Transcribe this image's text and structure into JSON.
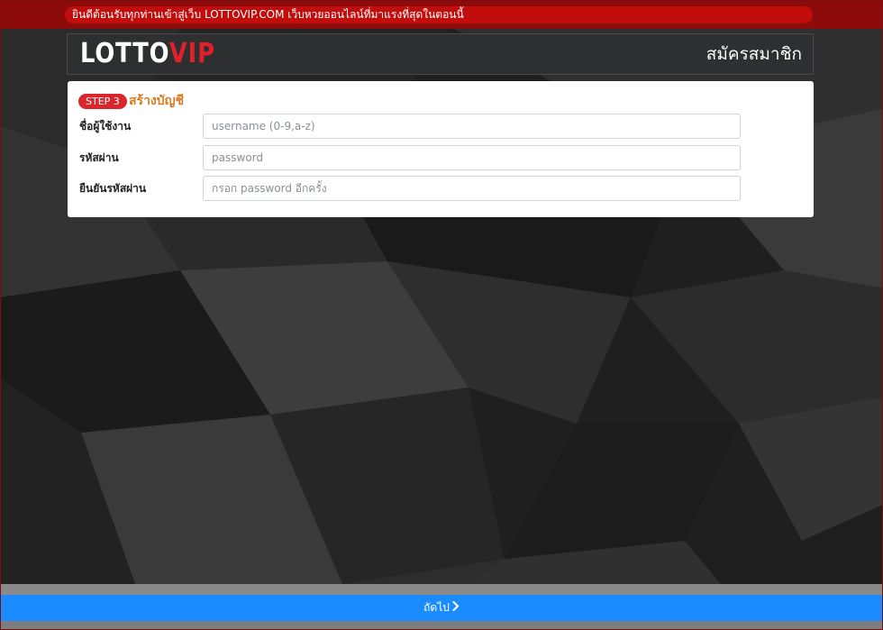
{
  "announcement": {
    "text": "ยินดีต้อนรับทุกท่านเข้าสู่เว็บ LOTTOVIP.COM เว็บหวยออนไลน์ที่มาแรงที่สุดในตอนนี้"
  },
  "header": {
    "logo_white": "LOTTO",
    "logo_red": "VIP",
    "title": "สมัครสมาชิก"
  },
  "step": {
    "badge": "STEP 3",
    "title": "สร้างบัญชี"
  },
  "form": {
    "username": {
      "label": "ชื่อผู้ใช้งาน",
      "placeholder": "username (0-9,a-z)",
      "value": ""
    },
    "password": {
      "label": "รหัสผ่าน",
      "placeholder": "password",
      "value": ""
    },
    "confirm": {
      "label": "ยืนยันรหัสผ่าน",
      "placeholder": "กรอก password อีกครั้ง",
      "value": ""
    }
  },
  "footer": {
    "next_label": "ถัดไป"
  },
  "colors": {
    "announce_bg": "#8e0b0b",
    "announce_pill": "#c20d0d",
    "logo_red": "#e0202a",
    "step_badge": "#d9262c",
    "step_title": "#d77a25",
    "next_button": "#1a8cff"
  },
  "icons": {
    "next": "chevron-right-icon"
  }
}
